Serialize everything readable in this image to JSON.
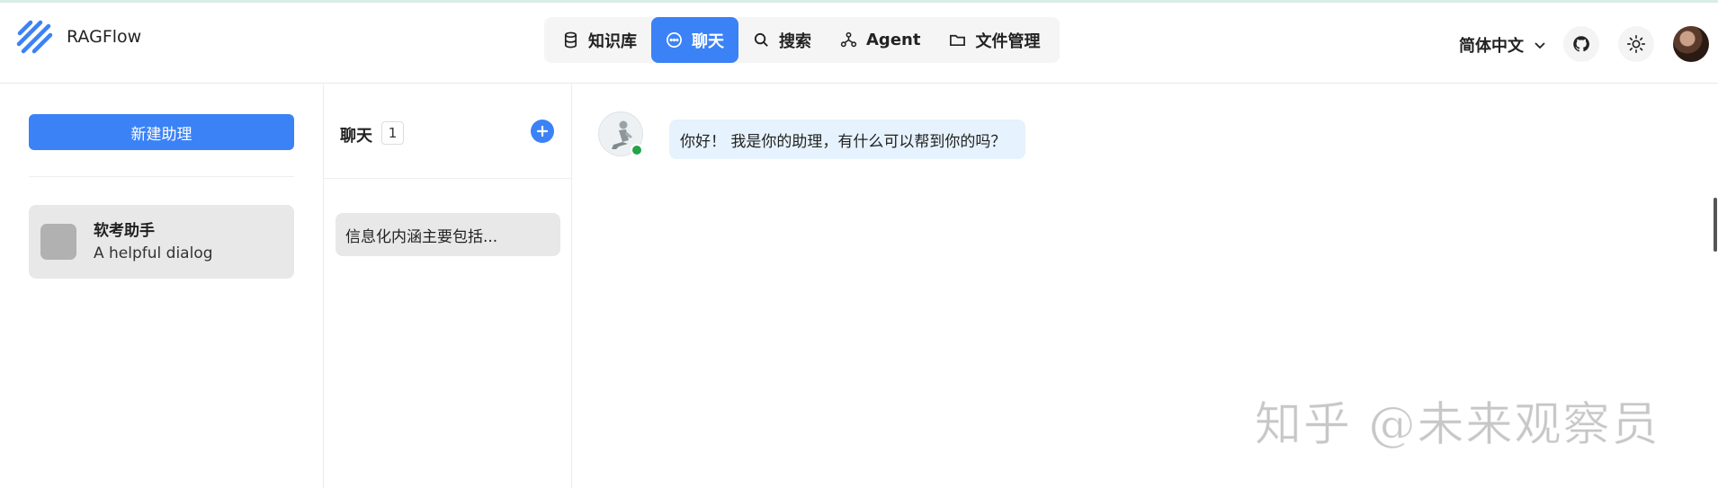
{
  "app": {
    "name": "RAGFlow"
  },
  "nav": {
    "items": [
      {
        "label": "知识库",
        "icon": "database-icon"
      },
      {
        "label": "聊天",
        "icon": "chat-icon",
        "active": true
      },
      {
        "label": "搜索",
        "icon": "search-icon"
      },
      {
        "label": "Agent",
        "icon": "agent-icon"
      },
      {
        "label": "文件管理",
        "icon": "folder-icon"
      }
    ]
  },
  "header_right": {
    "language": "简体中文",
    "icons": [
      "github-icon",
      "sun-icon",
      "user-avatar"
    ]
  },
  "sidebar": {
    "new_button": "新建助理",
    "assistants": [
      {
        "name": "软考助手",
        "description": "A helpful dialog"
      }
    ]
  },
  "chats": {
    "title": "聊天",
    "count": "1",
    "items": [
      {
        "title": "信息化内涵主要包括..."
      }
    ]
  },
  "conversation": {
    "messages": [
      {
        "role": "assistant",
        "text": "你好！ 我是你的助理，有什么可以帮到你的吗？"
      }
    ]
  },
  "watermark": "知乎 @未来观察员",
  "colors": {
    "accent": "#3b82f6",
    "online": "#22a447",
    "bubble": "#e6f2fd",
    "card": "#e8e8e8"
  }
}
